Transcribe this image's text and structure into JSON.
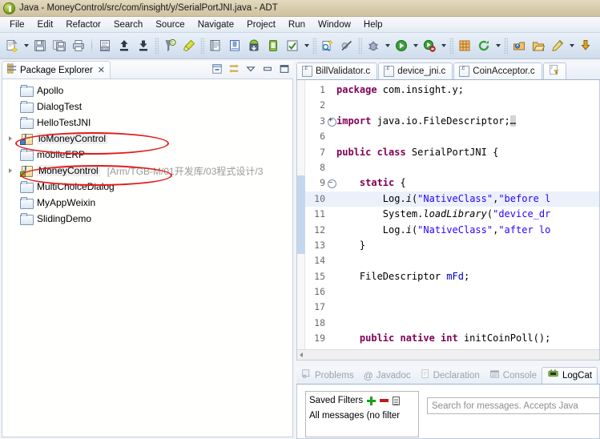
{
  "window": {
    "title": "Java - MoneyControl/src/com/insight/y/SerialPortJNI.java - ADT",
    "app_icon": "eclipse-adt-icon"
  },
  "menubar": {
    "items": [
      {
        "label": "File"
      },
      {
        "label": "Edit"
      },
      {
        "label": "Refactor"
      },
      {
        "label": "Search"
      },
      {
        "label": "Source"
      },
      {
        "label": "Navigate"
      },
      {
        "label": "Project"
      },
      {
        "label": "Run"
      },
      {
        "label": "Window"
      },
      {
        "label": "Help"
      }
    ]
  },
  "toolbar": {
    "groups": [
      {
        "buttons": [
          {
            "icon": "new-wizard-icon",
            "dropdown": true
          },
          {
            "icon": "save-icon",
            "dropdown": false
          },
          {
            "icon": "save-all-icon",
            "dropdown": false
          },
          {
            "icon": "print-icon",
            "dropdown": false
          }
        ]
      },
      {
        "buttons": [
          {
            "icon": "build-binary-icon",
            "dropdown": false
          },
          {
            "icon": "export-icon",
            "dropdown": false
          },
          {
            "icon": "import-icon",
            "dropdown": false
          },
          {
            "icon": "search-icon",
            "dropdown": false
          },
          {
            "icon": "highlight-marker-icon",
            "dropdown": false
          }
        ]
      },
      {
        "buttons": [
          {
            "icon": "open-type-icon",
            "dropdown": false
          },
          {
            "icon": "open-task-icon",
            "dropdown": false
          },
          {
            "icon": "android-sdk-manager-icon",
            "dropdown": false
          },
          {
            "icon": "android-avd-manager-icon",
            "dropdown": false
          },
          {
            "icon": "lint-check-icon",
            "dropdown": true
          }
        ]
      },
      {
        "buttons": [
          {
            "icon": "new-android-project-icon",
            "dropdown": false
          },
          {
            "icon": "skip-breakpoints-icon",
            "dropdown": false
          },
          {
            "icon": "debug-icon",
            "dropdown": true
          },
          {
            "icon": "run-icon",
            "dropdown": true
          },
          {
            "icon": "external-tools-icon",
            "dropdown": true
          }
        ]
      },
      {
        "buttons": [
          {
            "icon": "new-java-package-icon",
            "dropdown": false
          },
          {
            "icon": "refresh-icon",
            "dropdown": true
          }
        ]
      },
      {
        "buttons": [
          {
            "icon": "open-type-hierarchy-icon",
            "dropdown": false
          },
          {
            "icon": "open-resource-icon",
            "dropdown": false
          },
          {
            "icon": "annotation-icon",
            "dropdown": true
          },
          {
            "icon": "next-annotation-icon",
            "dropdown": false
          }
        ]
      }
    ]
  },
  "package_explorer": {
    "tab_label": "Package Explorer",
    "tab_icon": "package-explorer-icon",
    "close_icon": "close-icon",
    "tools": [
      {
        "name": "collapse-all-icon"
      },
      {
        "name": "link-with-editor-icon"
      },
      {
        "name": "view-menu-icon"
      },
      {
        "name": "minimize-icon"
      },
      {
        "name": "maximize-icon"
      }
    ],
    "tree": [
      {
        "label": "Apollo",
        "icon": "folder-icon",
        "path": "",
        "expandable": false,
        "selected": false,
        "circled": false
      },
      {
        "label": "DialogTest",
        "icon": "folder-icon",
        "path": "",
        "expandable": false,
        "selected": false,
        "circled": false
      },
      {
        "label": "HelloTestJNI",
        "icon": "folder-icon",
        "path": "",
        "expandable": false,
        "selected": false,
        "circled": false
      },
      {
        "label": "ioMoneyControl",
        "icon": "java-project-icon",
        "path": "",
        "expandable": true,
        "selected": true,
        "circled": true
      },
      {
        "label": "mobileERP",
        "icon": "folder-icon",
        "path": "",
        "expandable": false,
        "selected": false,
        "circled": false
      },
      {
        "label": "MoneyControl",
        "icon": "android-project-icon",
        "path": "[Arm/TGB-M/01开发库/03程式设计/3",
        "expandable": true,
        "selected": true,
        "circled": true
      },
      {
        "label": "MultiChoiceDialog",
        "icon": "folder-icon",
        "path": "",
        "expandable": false,
        "selected": false,
        "circled": false
      },
      {
        "label": "MyAppWeixin",
        "icon": "folder-icon",
        "path": "",
        "expandable": false,
        "selected": false,
        "circled": false
      },
      {
        "label": "SlidingDemo",
        "icon": "folder-icon",
        "path": "",
        "expandable": false,
        "selected": false,
        "circled": false
      }
    ]
  },
  "editor": {
    "tabs": [
      {
        "label": "BillValidator.c",
        "icon": "c-file-icon",
        "active": false
      },
      {
        "label": "device_jni.c",
        "icon": "c-file-icon",
        "active": false
      },
      {
        "label": "CoinAcceptor.c",
        "icon": "c-file-icon",
        "active": false
      },
      {
        "label": "",
        "icon": "java-file-warning-icon",
        "active": true
      }
    ],
    "current_line": 10,
    "lines": [
      {
        "n": 1,
        "fold": "",
        "text": "package com.insight.y;",
        "tokens": [
          {
            "t": "package",
            "c": "kw"
          },
          {
            "t": " com.insight.y;",
            "c": ""
          }
        ]
      },
      {
        "n": 2,
        "fold": "",
        "text": "",
        "tokens": []
      },
      {
        "n": 3,
        "fold": "plus",
        "text": "import java.io.FileDescriptor;",
        "tokens": [
          {
            "t": "import",
            "c": "kw"
          },
          {
            "t": " java.io.FileDescriptor;",
            "c": ""
          },
          {
            "t": "…",
            "c": "occ"
          }
        ]
      },
      {
        "n": 6,
        "fold": "",
        "text": "",
        "tokens": []
      },
      {
        "n": 7,
        "fold": "",
        "text": "public class SerialPortJNI {",
        "tokens": [
          {
            "t": "public class",
            "c": "kw"
          },
          {
            "t": " SerialPortJNI {",
            "c": ""
          }
        ]
      },
      {
        "n": 8,
        "fold": "",
        "text": "",
        "tokens": []
      },
      {
        "n": 9,
        "fold": "minus",
        "text": "    static {",
        "tokens": [
          {
            "t": "    ",
            "c": ""
          },
          {
            "t": "static",
            "c": "kw"
          },
          {
            "t": " {",
            "c": ""
          }
        ]
      },
      {
        "n": 10,
        "fold": "",
        "text": "        Log.i(\"NativeClass\",\"before l",
        "tokens": [
          {
            "t": "        Log.",
            "c": ""
          },
          {
            "t": "i",
            "c": "stat"
          },
          {
            "t": "(",
            "c": ""
          },
          {
            "t": "\"NativeClass\"",
            "c": "str"
          },
          {
            "t": ",",
            "c": ""
          },
          {
            "t": "\"before l",
            "c": "str"
          }
        ]
      },
      {
        "n": 11,
        "fold": "",
        "text": "        System.loadLibrary(\"device_dr",
        "tokens": [
          {
            "t": "        System.",
            "c": ""
          },
          {
            "t": "loadLibrary",
            "c": "stat"
          },
          {
            "t": "(",
            "c": ""
          },
          {
            "t": "\"device_dr",
            "c": "str"
          }
        ]
      },
      {
        "n": 12,
        "fold": "",
        "text": "        Log.i(\"NativeClass\",\"after lo",
        "tokens": [
          {
            "t": "        Log.",
            "c": ""
          },
          {
            "t": "i",
            "c": "stat"
          },
          {
            "t": "(",
            "c": ""
          },
          {
            "t": "\"NativeClass\"",
            "c": "str"
          },
          {
            "t": ",",
            "c": ""
          },
          {
            "t": "\"after lo",
            "c": "str"
          }
        ]
      },
      {
        "n": 13,
        "fold": "",
        "text": "    }",
        "tokens": [
          {
            "t": "    }",
            "c": ""
          }
        ]
      },
      {
        "n": 14,
        "fold": "",
        "text": "",
        "tokens": []
      },
      {
        "n": 15,
        "fold": "",
        "text": "    FileDescriptor mFd;",
        "tokens": [
          {
            "t": "    FileDescriptor ",
            "c": ""
          },
          {
            "t": "mFd",
            "c": "fld"
          },
          {
            "t": ";",
            "c": ""
          }
        ]
      },
      {
        "n": 16,
        "fold": "",
        "text": "",
        "tokens": []
      },
      {
        "n": 17,
        "fold": "",
        "text": "",
        "tokens": []
      },
      {
        "n": 18,
        "fold": "",
        "text": "",
        "tokens": []
      },
      {
        "n": 19,
        "fold": "",
        "text": "    public native int initCoinPoll();",
        "tokens": [
          {
            "t": "    ",
            "c": ""
          },
          {
            "t": "public native int",
            "c": "kw"
          },
          {
            "t": " initCoinPoll();",
            "c": ""
          }
        ]
      }
    ]
  },
  "bottom": {
    "tabs": [
      {
        "label": "Problems",
        "icon": "problems-icon",
        "active": false
      },
      {
        "label": "Javadoc",
        "icon": "javadoc-icon",
        "active": false
      },
      {
        "label": "Declaration",
        "icon": "declaration-icon",
        "active": false
      },
      {
        "label": "Console",
        "icon": "console-icon",
        "active": false
      },
      {
        "label": "LogCat",
        "icon": "logcat-icon",
        "active": true
      }
    ],
    "logcat": {
      "saved_filters_label": "Saved Filters",
      "add_filter_icon": "plus-icon",
      "remove_filter_icon": "minus-icon",
      "edit_filter_icon": "edit-filter-icon",
      "filter_items": [
        "All messages (no filter"
      ],
      "search_placeholder": "Search for messages. Accepts Java "
    }
  },
  "colors": {
    "title_bar": "#d9ceaf",
    "toolbar": "#dde7f3",
    "annotation_red": "#e21b1b",
    "keyword": "#7f0055",
    "string": "#2a00ff",
    "field": "#0000c0",
    "current_line": "#eaf1fb"
  }
}
